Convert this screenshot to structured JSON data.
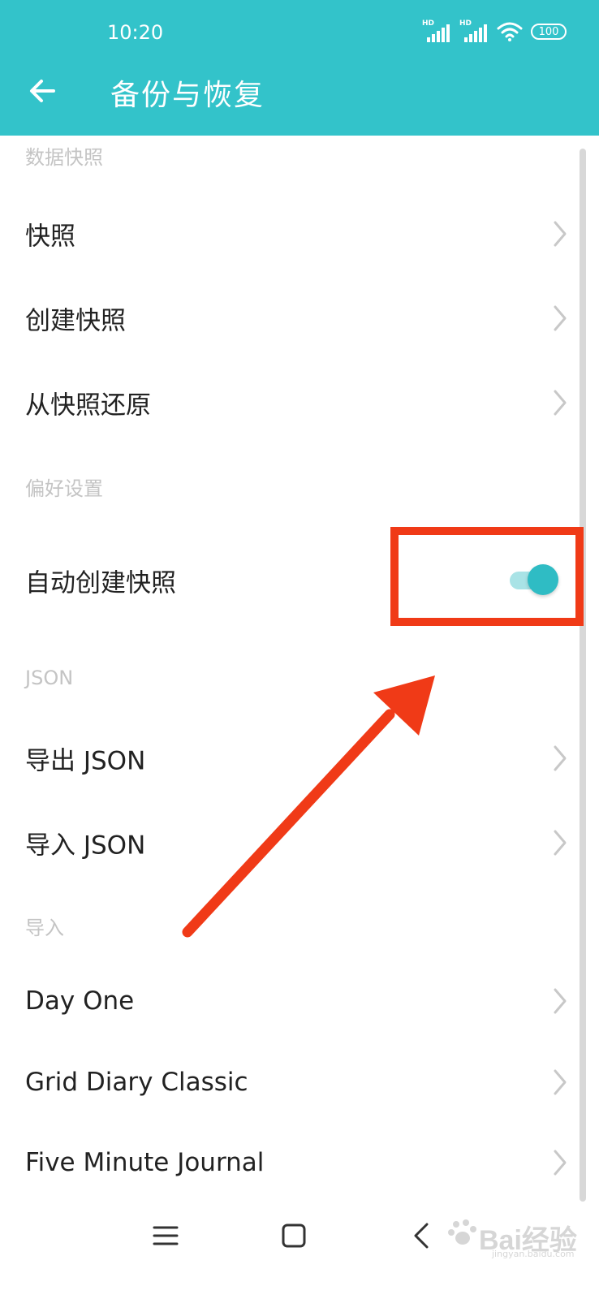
{
  "status_bar": {
    "time": "10:20",
    "signal1_label": "HD",
    "signal2_label": "HD",
    "battery": "100"
  },
  "header": {
    "title": "备份与恢复",
    "back_icon": "arrow-left-icon",
    "background_color": "#33c3ca"
  },
  "sections": {
    "snapshots": {
      "header": "数据快照",
      "items": [
        "快照",
        "创建快照",
        "从快照还原"
      ]
    },
    "preferences": {
      "header": "偏好设置",
      "auto_snapshot_label": "自动创建快照",
      "auto_snapshot_enabled": true
    },
    "json": {
      "header": "JSON",
      "items": [
        "导出 JSON",
        "导入 JSON"
      ]
    },
    "import": {
      "header": "导入",
      "items": [
        "Day One",
        "Grid Diary Classic",
        "Five Minute Journal"
      ]
    }
  },
  "annotation": {
    "color": "#f03a17"
  },
  "watermark": {
    "text": "Bai经验",
    "sub": "jingyan.baidu.com"
  }
}
